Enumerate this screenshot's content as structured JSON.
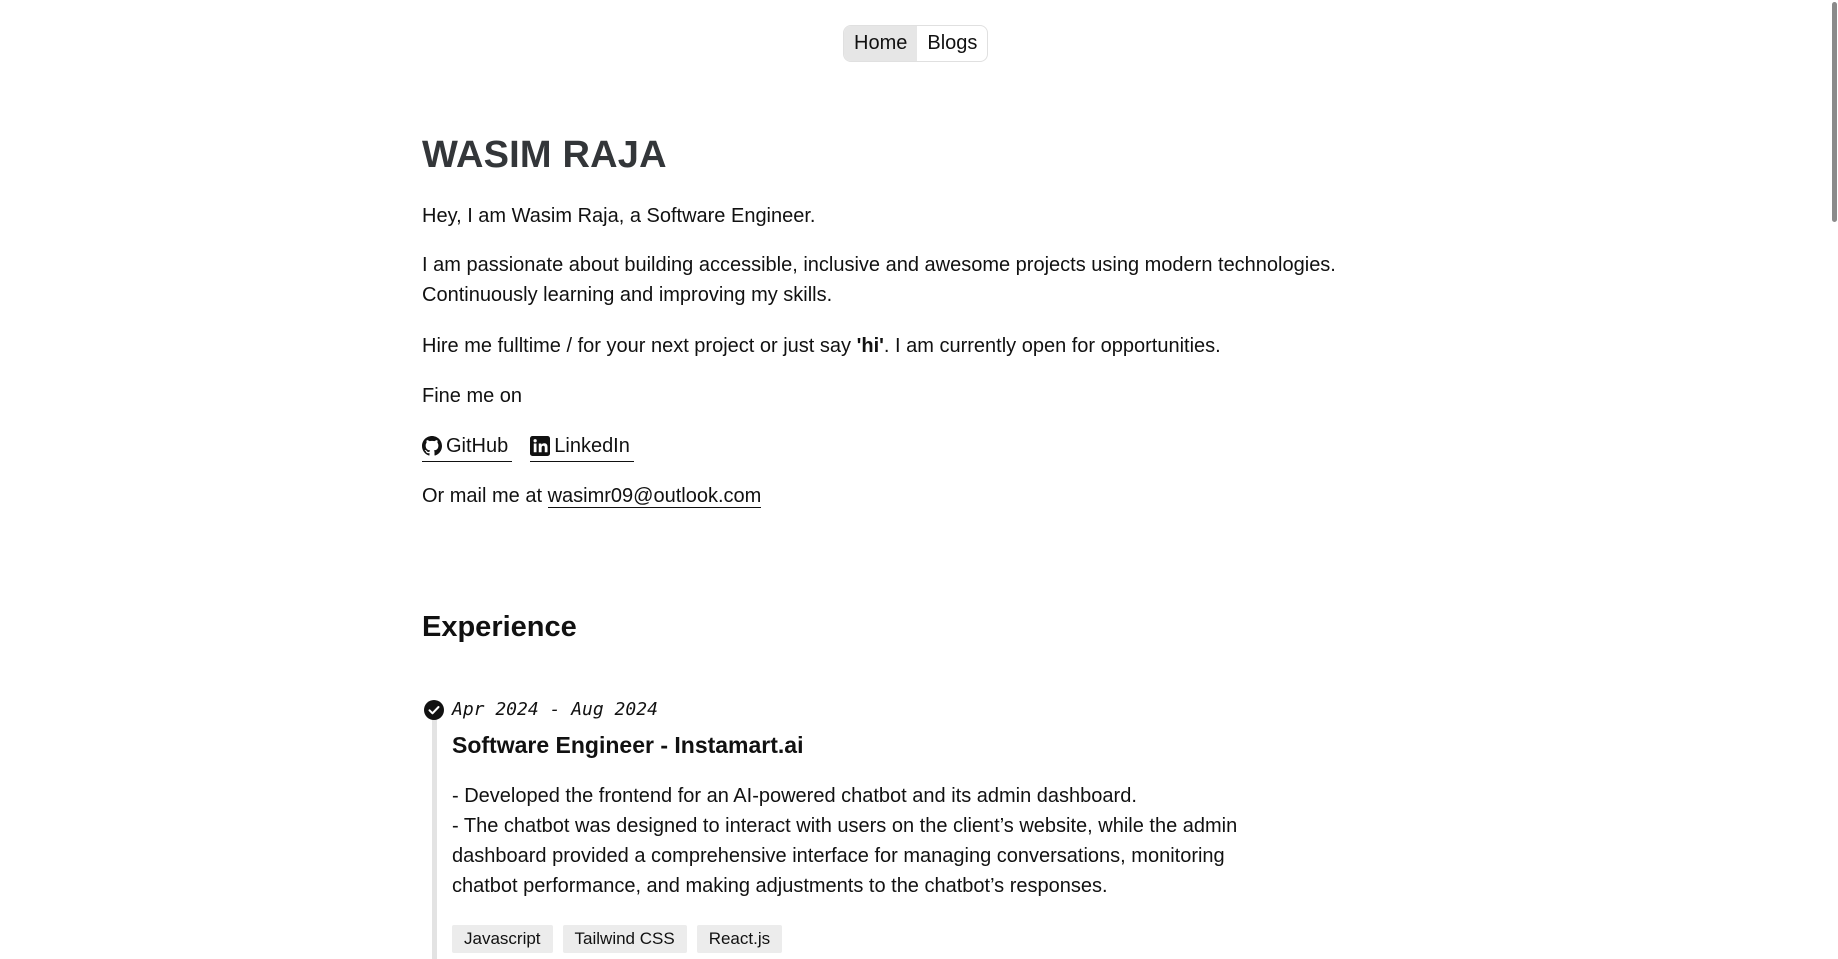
{
  "nav": {
    "home": "Home",
    "blogs": "Blogs"
  },
  "hero": {
    "name": "WASIM RAJA",
    "intro": "Hey, I am Wasim Raja, a Software Engineer.",
    "passion_1": "I am passionate about building accessible, inclusive and awesome projects using modern technologies.",
    "passion_2": "Continuously learning and improving my skills.",
    "hire_prefix": "Hire me fulltime / for your next project or just say ",
    "hire_bold": "'hi'",
    "hire_suffix": ". I am currently open for opportunities.",
    "find_me": "Fine me on",
    "socials": {
      "github": " GitHub ",
      "linkedin": " LinkedIn"
    },
    "mail_prefix": "Or mail me at ",
    "mail": "wasimr09@outlook.com"
  },
  "experience": {
    "title": "Experience",
    "items": [
      {
        "dates": "Apr 2024 - Aug 2024",
        "role": "Software Engineer - Instamart.ai",
        "lines": [
          "- Developed the frontend for an AI-powered chatbot and its admin dashboard.",
          "- The chatbot was designed to interact with users on the client’s website, while the admin dashboard provided a comprehensive interface for managing conversations, monitoring chatbot performance, and making adjustments to the chatbot’s responses."
        ],
        "tags": [
          "Javascript",
          "Tailwind CSS",
          "React.js"
        ]
      }
    ]
  }
}
